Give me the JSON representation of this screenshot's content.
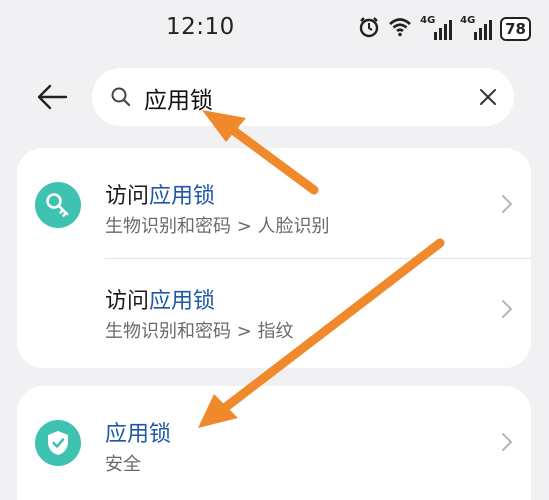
{
  "status_bar": {
    "time": "12:10",
    "network_label_1": "4G",
    "network_label_2": "4G",
    "battery": "78"
  },
  "search": {
    "query": "应用锁"
  },
  "results": [
    {
      "title_prefix": "访问",
      "title_highlight": "应用锁",
      "subtitle": "生物识别和密码 > 人脸识别",
      "icon": "key-icon"
    },
    {
      "title_prefix": "访问",
      "title_highlight": "应用锁",
      "subtitle": "生物识别和密码 > 指纹",
      "icon": ""
    },
    {
      "title_prefix": "",
      "title_highlight": "应用锁",
      "subtitle": "安全",
      "icon": "shield-icon"
    }
  ],
  "colors": {
    "highlight": "#1f58a8",
    "icon_teal": "#3ec2b1",
    "arrow_orange": "#f0892b"
  }
}
